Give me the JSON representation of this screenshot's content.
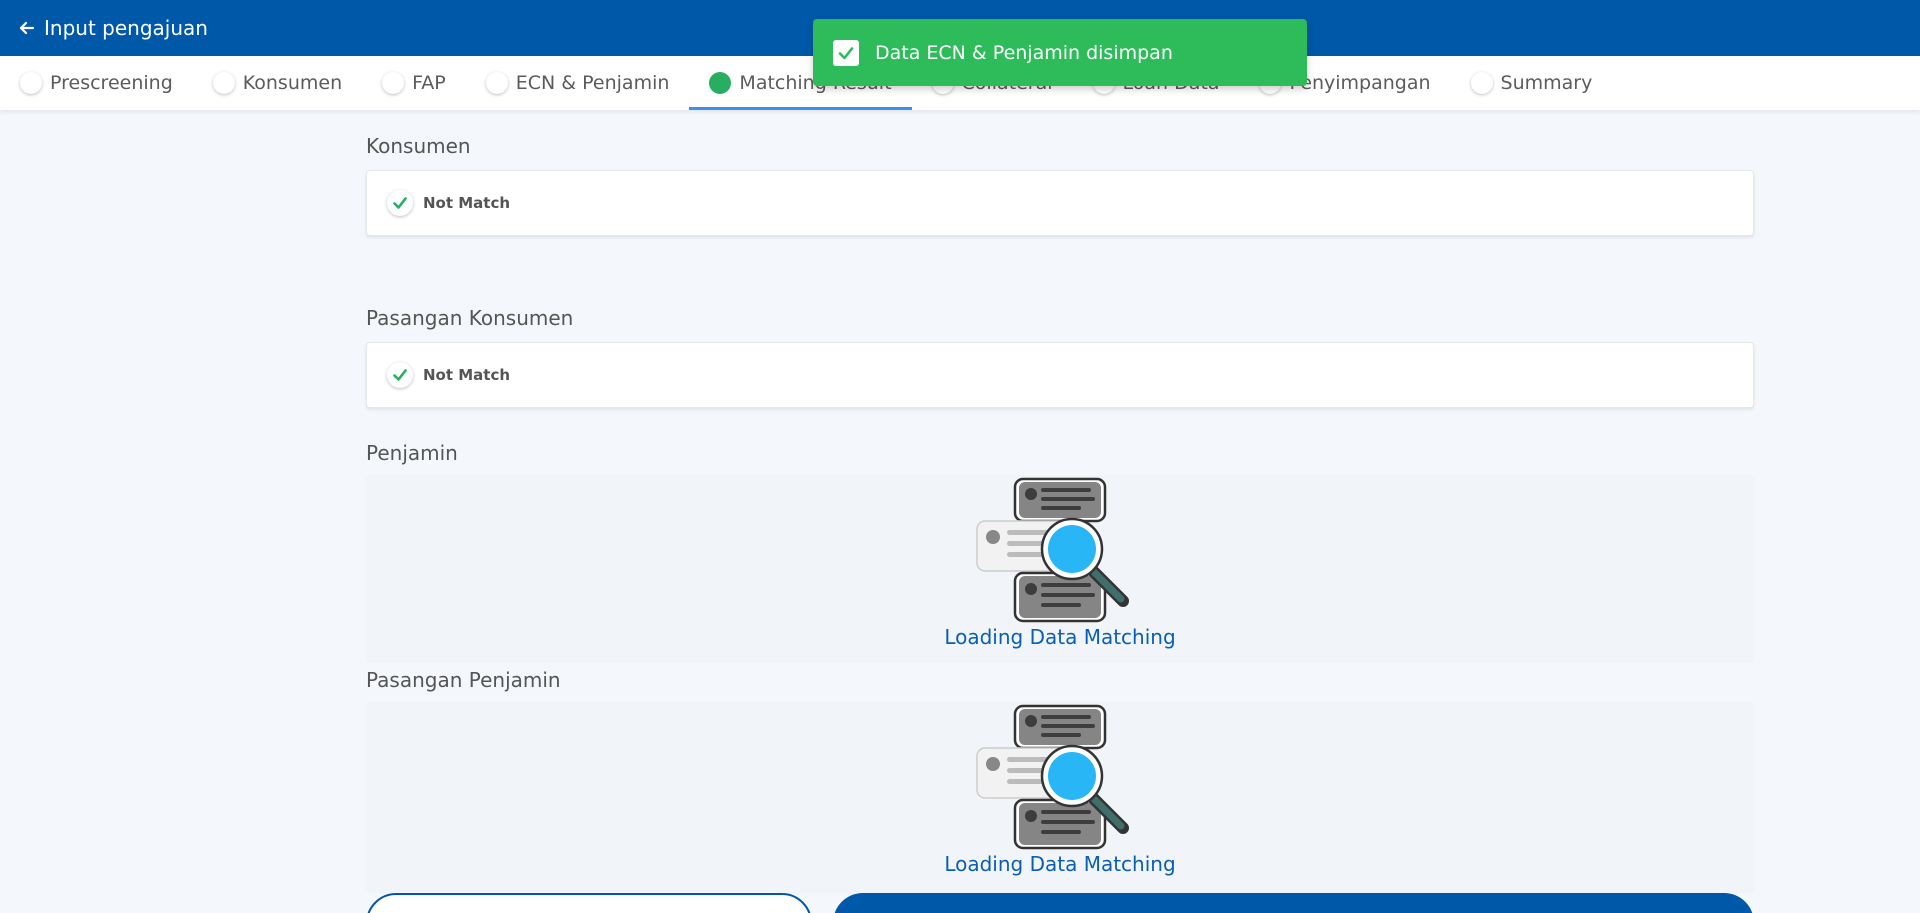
{
  "header": {
    "title": "Input pengajuan"
  },
  "tabs": [
    {
      "label": "Prescreening"
    },
    {
      "label": "Konsumen"
    },
    {
      "label": "FAP"
    },
    {
      "label": "ECN & Penjamin"
    },
    {
      "label": "Matching Result",
      "active": true
    },
    {
      "label": "Collateral"
    },
    {
      "label": "Loan Data"
    },
    {
      "label": "Penyimpangan"
    },
    {
      "label": "Summary"
    }
  ],
  "toast": {
    "message": "Data ECN & Penjamin disimpan"
  },
  "sections": {
    "konsumen": {
      "label": "Konsumen",
      "result": "Not Match"
    },
    "pasangan_konsumen": {
      "label": "Pasangan Konsumen",
      "result": "Not Match"
    },
    "penjamin": {
      "label": "Penjamin",
      "loading": "Loading Data Matching"
    },
    "pasangan_penjamin": {
      "label": "Pasangan Penjamin",
      "loading": "Loading Data Matching"
    }
  },
  "colors": {
    "primary": "#0058a8",
    "success": "#2ebc5a",
    "link": "#0a5fb4"
  },
  "icons": {
    "back": "arrow-left-icon",
    "check": "check-icon",
    "loading": "data-search-illustration"
  }
}
